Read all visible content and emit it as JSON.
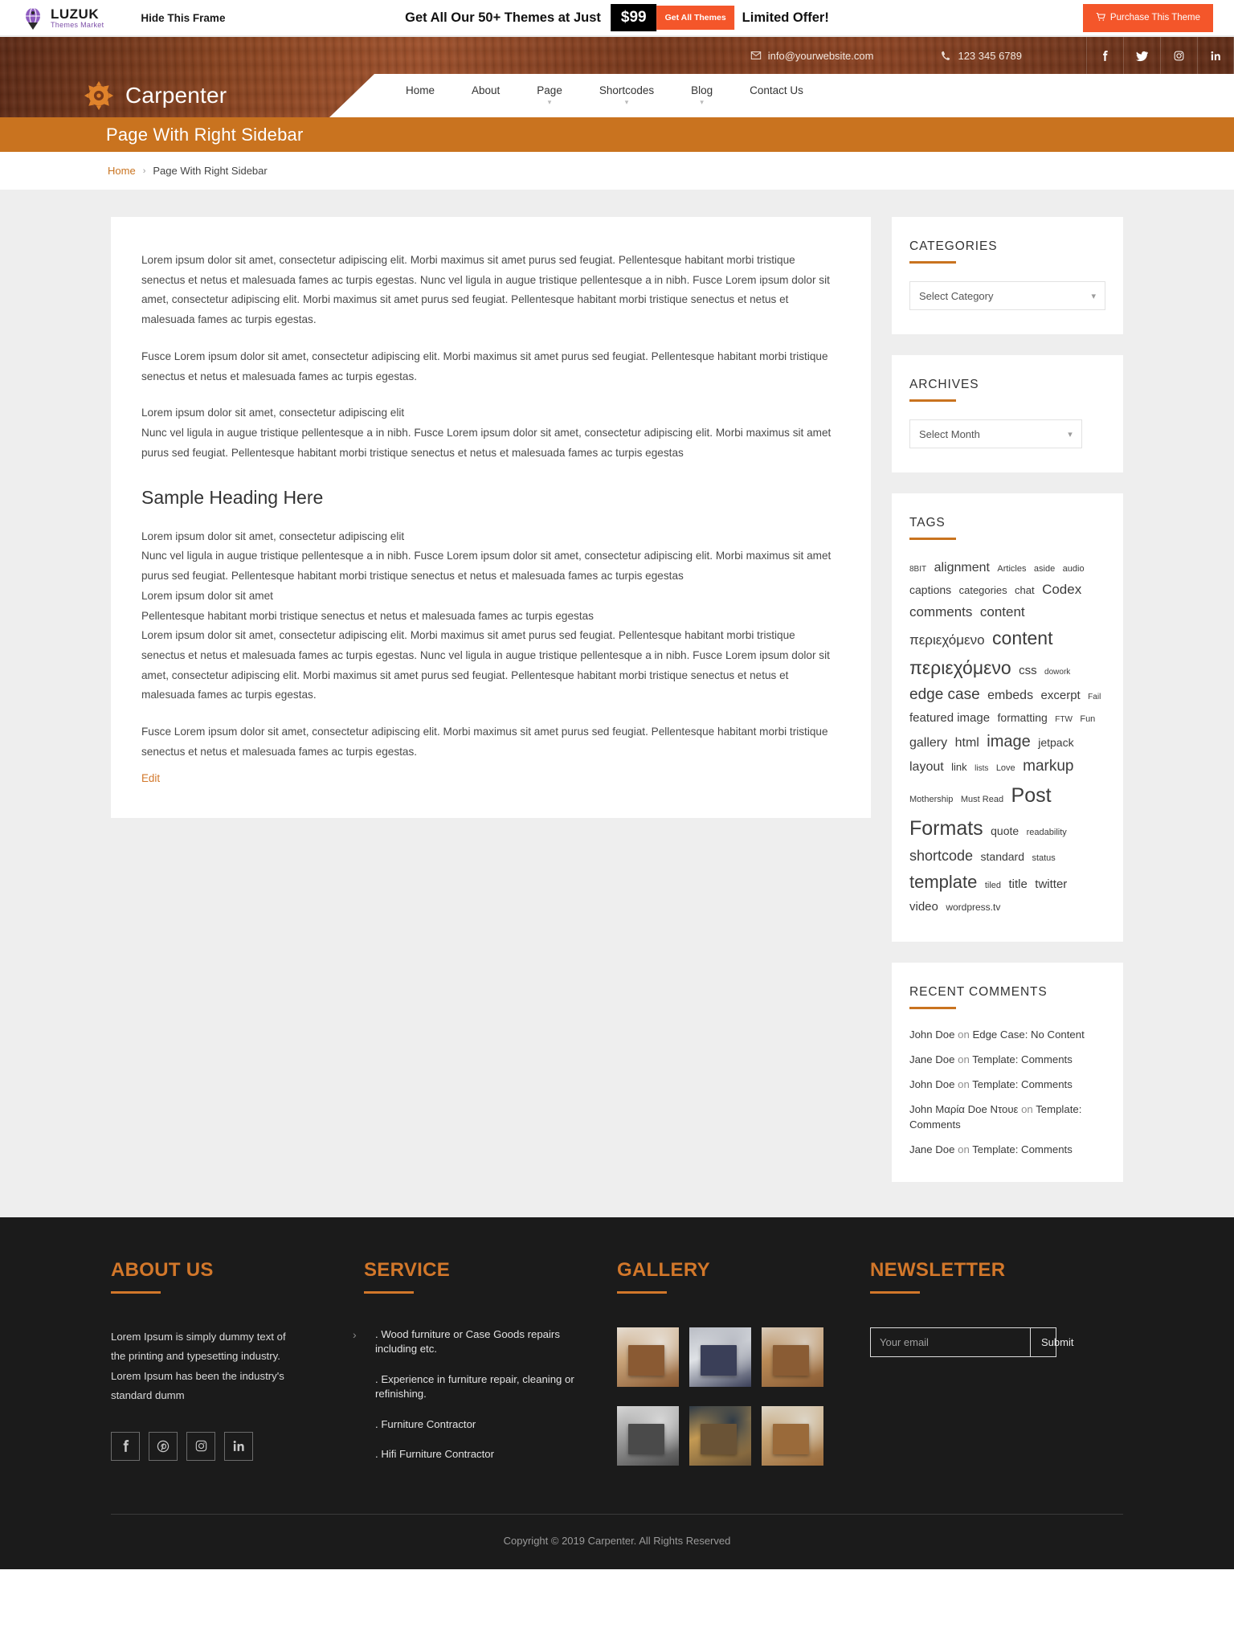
{
  "promo": {
    "brand_main": "LUZUK",
    "brand_sub": "Themes Market",
    "hide_frame": "Hide This Frame",
    "offer_text": "Get All Our 50+ Themes at Just",
    "price": "$99",
    "get_all_label": "Get All Themes",
    "limited": "Limited Offer!",
    "purchase_label": "Purchase This Theme",
    "accent": "#f4562a"
  },
  "topbar": {
    "email": "info@yourwebsite.com",
    "phone": "123 345 6789",
    "socials": [
      "facebook-icon",
      "twitter-icon",
      "instagram-icon",
      "linkedin-icon"
    ]
  },
  "header": {
    "brand": "Carpenter",
    "nav": [
      {
        "label": "Home",
        "has_caret": false
      },
      {
        "label": "About",
        "has_caret": false
      },
      {
        "label": "Page",
        "has_caret": true
      },
      {
        "label": "Shortcodes",
        "has_caret": true
      },
      {
        "label": "Blog",
        "has_caret": true
      },
      {
        "label": "Contact Us",
        "has_caret": false
      }
    ]
  },
  "page": {
    "title": "Page With Right Sidebar",
    "breadcrumb_home": "Home",
    "breadcrumb_sep": "›",
    "breadcrumb_current": "Page With Right Sidebar",
    "title_bg": "#c9731f"
  },
  "content": {
    "p1": "Lorem ipsum dolor sit amet, consectetur adipiscing elit. Morbi maximus sit amet purus sed feugiat. Pellentesque habitant morbi tristique senectus et netus et malesuada fames ac turpis egestas. Nunc vel ligula in augue tristique pellentesque a in nibh. Fusce Lorem ipsum dolor sit amet, consectetur adipiscing elit. Morbi maximus sit amet purus sed feugiat. Pellentesque habitant morbi tristique senectus et netus et malesuada fames ac turpis egestas.",
    "p2": "Fusce Lorem ipsum dolor sit amet, consectetur adipiscing elit. Morbi maximus sit amet purus sed feugiat. Pellentesque habitant morbi tristique senectus et netus et malesuada fames ac turpis egestas.",
    "p3_line1": "Lorem ipsum dolor sit amet, consectetur adipiscing elit",
    "p3_line2": "Nunc vel ligula in augue tristique pellentesque a in nibh. Fusce Lorem ipsum dolor sit amet, consectetur adipiscing elit. Morbi maximus sit amet purus sed feugiat. Pellentesque habitant morbi tristique senectus et netus et malesuada fames ac turpis egestas",
    "heading": "Sample Heading Here",
    "p4_line1": "Lorem ipsum dolor sit amet, consectetur adipiscing elit",
    "p4_line2": "Nunc vel ligula in augue tristique pellentesque a in nibh. Fusce Lorem ipsum dolor sit amet, consectetur adipiscing elit. Morbi maximus sit amet purus sed feugiat. Pellentesque habitant morbi tristique senectus et netus et malesuada fames ac turpis egestas",
    "p4_line3": "Lorem ipsum dolor sit amet",
    "p4_line4": "Pellentesque habitant morbi tristique senectus et netus et malesuada fames ac turpis egestas",
    "p4_line5": "Lorem ipsum dolor sit amet, consectetur adipiscing elit. Morbi maximus sit amet purus sed feugiat. Pellentesque habitant morbi tristique senectus et netus et malesuada fames ac turpis egestas. Nunc vel ligula in augue tristique pellentesque a in nibh. Fusce Lorem ipsum dolor sit amet, consectetur adipiscing elit. Morbi maximus sit amet purus sed feugiat. Pellentesque habitant morbi tristique senectus et netus et malesuada fames ac turpis egestas.",
    "p5": "Fusce Lorem ipsum dolor sit amet, consectetur adipiscing elit. Morbi maximus sit amet purus sed feugiat. Pellentesque habitant morbi tristique senectus et netus et malesuada fames ac turpis egestas.",
    "edit_label": "Edit"
  },
  "sidebar": {
    "categories": {
      "title": "CATEGORIES",
      "selected": "Select Category"
    },
    "archives": {
      "title": "ARCHIVES",
      "selected": "Select Month"
    },
    "tags": {
      "title": "TAGS",
      "items": [
        {
          "label": "8BIT",
          "size": 10
        },
        {
          "label": "alignment",
          "size": 16
        },
        {
          "label": "Articles",
          "size": 11
        },
        {
          "label": "aside",
          "size": 11
        },
        {
          "label": "audio",
          "size": 11
        },
        {
          "label": "captions",
          "size": 14
        },
        {
          "label": "categories",
          "size": 13
        },
        {
          "label": "chat",
          "size": 13
        },
        {
          "label": "Codex",
          "size": 17
        },
        {
          "label": "comments",
          "size": 17
        },
        {
          "label": "content περιεχόμενο",
          "size": 17
        },
        {
          "label": "content περιεχόμενο",
          "size": 23
        },
        {
          "label": "css",
          "size": 15
        },
        {
          "label": "dowork",
          "size": 10
        },
        {
          "label": "edge case",
          "size": 19
        },
        {
          "label": "embeds",
          "size": 16
        },
        {
          "label": "excerpt",
          "size": 15
        },
        {
          "label": "Fail",
          "size": 10
        },
        {
          "label": "featured image",
          "size": 15
        },
        {
          "label": "formatting",
          "size": 14
        },
        {
          "label": "FTW",
          "size": 10
        },
        {
          "label": "Fun",
          "size": 11
        },
        {
          "label": "gallery",
          "size": 16
        },
        {
          "label": "html",
          "size": 16
        },
        {
          "label": "image",
          "size": 20
        },
        {
          "label": "jetpack",
          "size": 14
        },
        {
          "label": "layout",
          "size": 16
        },
        {
          "label": "link",
          "size": 13
        },
        {
          "label": "lists",
          "size": 10
        },
        {
          "label": "Love",
          "size": 11
        },
        {
          "label": "markup",
          "size": 19
        },
        {
          "label": "Mothership",
          "size": 11
        },
        {
          "label": "Must Read",
          "size": 11
        },
        {
          "label": "Post Formats",
          "size": 25
        },
        {
          "label": "quote",
          "size": 14
        },
        {
          "label": "readability",
          "size": 11
        },
        {
          "label": "shortcode",
          "size": 18
        },
        {
          "label": "standard",
          "size": 14
        },
        {
          "label": "status",
          "size": 11
        },
        {
          "label": "template",
          "size": 22
        },
        {
          "label": "tiled",
          "size": 11
        },
        {
          "label": "title",
          "size": 15
        },
        {
          "label": "twitter",
          "size": 15
        },
        {
          "label": "video",
          "size": 15
        },
        {
          "label": "wordpress.tv",
          "size": 12
        }
      ]
    },
    "recent_comments": {
      "title": "RECENT COMMENTS",
      "items": [
        {
          "author": "John Doe",
          "on": "on",
          "post": "Edge Case: No Content"
        },
        {
          "author": "Jane Doe",
          "on": "on",
          "post": "Template: Comments"
        },
        {
          "author": "John Doe",
          "on": "on",
          "post": "Template: Comments"
        },
        {
          "author": "John Μαρία Doe Ντουε",
          "on": "on",
          "post": "Template: Comments"
        },
        {
          "author": "Jane Doe",
          "on": "on",
          "post": "Template: Comments"
        }
      ]
    }
  },
  "footer": {
    "about": {
      "title": "ABOUT US",
      "text": "Lorem Ipsum is simply dummy text of the printing and typesetting industry. Lorem Ipsum has been the industry's standard dumm",
      "socials": [
        "facebook-icon",
        "pinterest-icon",
        "instagram-icon",
        "linkedin-icon"
      ]
    },
    "service": {
      "title": "SERVICE",
      "items": [
        ". Wood furniture or Case Goods repairs including etc.",
        ". Experience in furniture repair, cleaning or refinishing.",
        ". Furniture Contractor",
        ". Hifi Furniture Contractor"
      ]
    },
    "gallery": {
      "title": "GALLERY",
      "thumbs": [
        "wine-cabinet-photo",
        "tufted-bed-photo",
        "wooden-dresser-photo",
        "grayscale-crate-photo",
        "dark-sideboard-photo",
        "nesting-tables-photo"
      ]
    },
    "newsletter": {
      "title": "NEWSLETTER",
      "placeholder": "Your email",
      "value": "",
      "submit_label": "Submit"
    },
    "copyright": "Copyright © 2019 Carpenter. All Rights Reserved",
    "accent": "#d2772a"
  }
}
